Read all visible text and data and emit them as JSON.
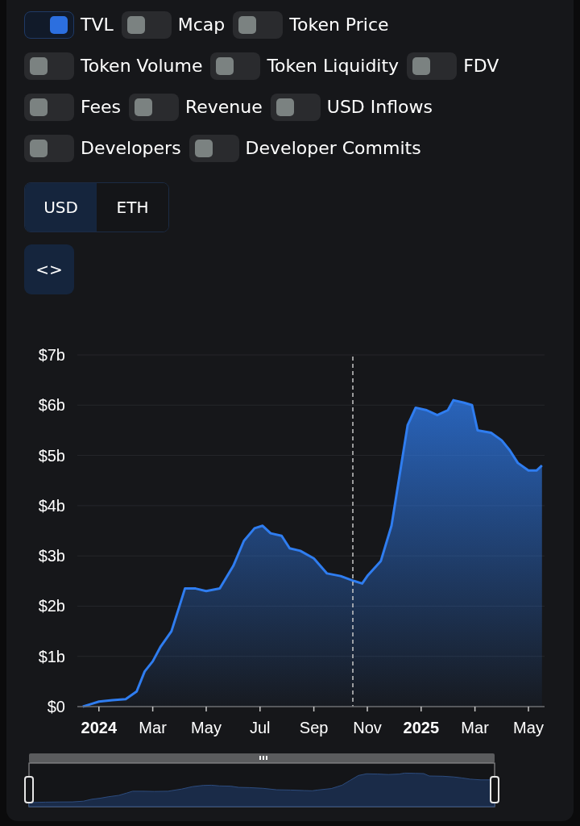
{
  "toggles": [
    {
      "label": "TVL",
      "on": true
    },
    {
      "label": "Mcap",
      "on": false
    },
    {
      "label": "Token Price",
      "on": false
    },
    {
      "label": "Token Volume",
      "on": false
    },
    {
      "label": "Token Liquidity",
      "on": false
    },
    {
      "label": "FDV",
      "on": false
    },
    {
      "label": "Fees",
      "on": false
    },
    {
      "label": "Revenue",
      "on": false
    },
    {
      "label": "USD Inflows",
      "on": false
    },
    {
      "label": "Developers",
      "on": false
    },
    {
      "label": "Developer Commits",
      "on": false
    }
  ],
  "denomination": [
    {
      "label": "USD",
      "selected": true
    },
    {
      "label": "ETH",
      "selected": false
    }
  ],
  "embed_button": {
    "label": "<>"
  },
  "chart": {
    "chart_data": {
      "type": "area",
      "x": [
        2023.95,
        2023.975,
        2024,
        2024.042,
        2024.083,
        2024.117,
        2024.142,
        2024.167,
        2024.192,
        2024.225,
        2024.25,
        2024.267,
        2024.3,
        2024.333,
        2024.375,
        2024.417,
        2024.45,
        2024.483,
        2024.508,
        2024.533,
        2024.567,
        2024.592,
        2024.625,
        2024.667,
        2024.708,
        2024.75,
        2024.792,
        2024.817,
        2024.833,
        2024.875,
        2024.908,
        2024.933,
        2024.958,
        2024.983,
        2025.017,
        2025.05,
        2025.083,
        2025.1,
        2025.133,
        2025.158,
        2025.175,
        2025.217,
        2025.25,
        2025.275,
        2025.3,
        2025.333,
        2025.358,
        2025.375
      ],
      "series": [
        {
          "color": "#2f7df0",
          "values": [
            0.0,
            0.05,
            0.1,
            0.13,
            0.15,
            0.3,
            0.7,
            0.9,
            1.2,
            1.5,
            2.0,
            2.35,
            2.35,
            2.3,
            2.35,
            2.8,
            3.3,
            3.55,
            3.6,
            3.45,
            3.4,
            3.15,
            3.1,
            2.95,
            2.65,
            2.6,
            2.5,
            2.45,
            2.6,
            2.9,
            3.6,
            4.6,
            5.6,
            5.95,
            5.9,
            5.8,
            5.9,
            6.1,
            6.05,
            6.0,
            5.5,
            5.45,
            5.3,
            5.1,
            4.85,
            4.7,
            4.7,
            4.8
          ]
        }
      ],
      "xlim": [
        2023.933,
        2025.383
      ],
      "ylim": [
        0,
        7
      ],
      "xticks": [
        2024,
        {
          "value": 2024.167,
          "label": "Mar"
        },
        {
          "value": 2024.333,
          "label": "May"
        },
        {
          "value": 2024.5,
          "label": "Jul"
        },
        {
          "value": 2024.667,
          "label": "Sep"
        },
        {
          "value": 2024.833,
          "label": "Nov"
        },
        2025,
        {
          "value": 2025.167,
          "label": "Mar"
        },
        {
          "value": 2025.333,
          "label": "May"
        }
      ],
      "yticks": [
        {
          "value": 0,
          "label": "$0"
        },
        {
          "value": 1,
          "label": "$1b"
        },
        {
          "value": 2,
          "label": "$2b"
        },
        {
          "value": 3,
          "label": "$3b"
        },
        {
          "value": 4,
          "label": "$4b"
        },
        {
          "value": 5,
          "label": "$5b"
        },
        {
          "value": 6,
          "label": "$6b"
        },
        {
          "value": 7,
          "label": "$7b"
        }
      ],
      "grid": true,
      "ref_lines": [
        {
          "axis": "x",
          "value": 2024.788
        }
      ]
    }
  }
}
